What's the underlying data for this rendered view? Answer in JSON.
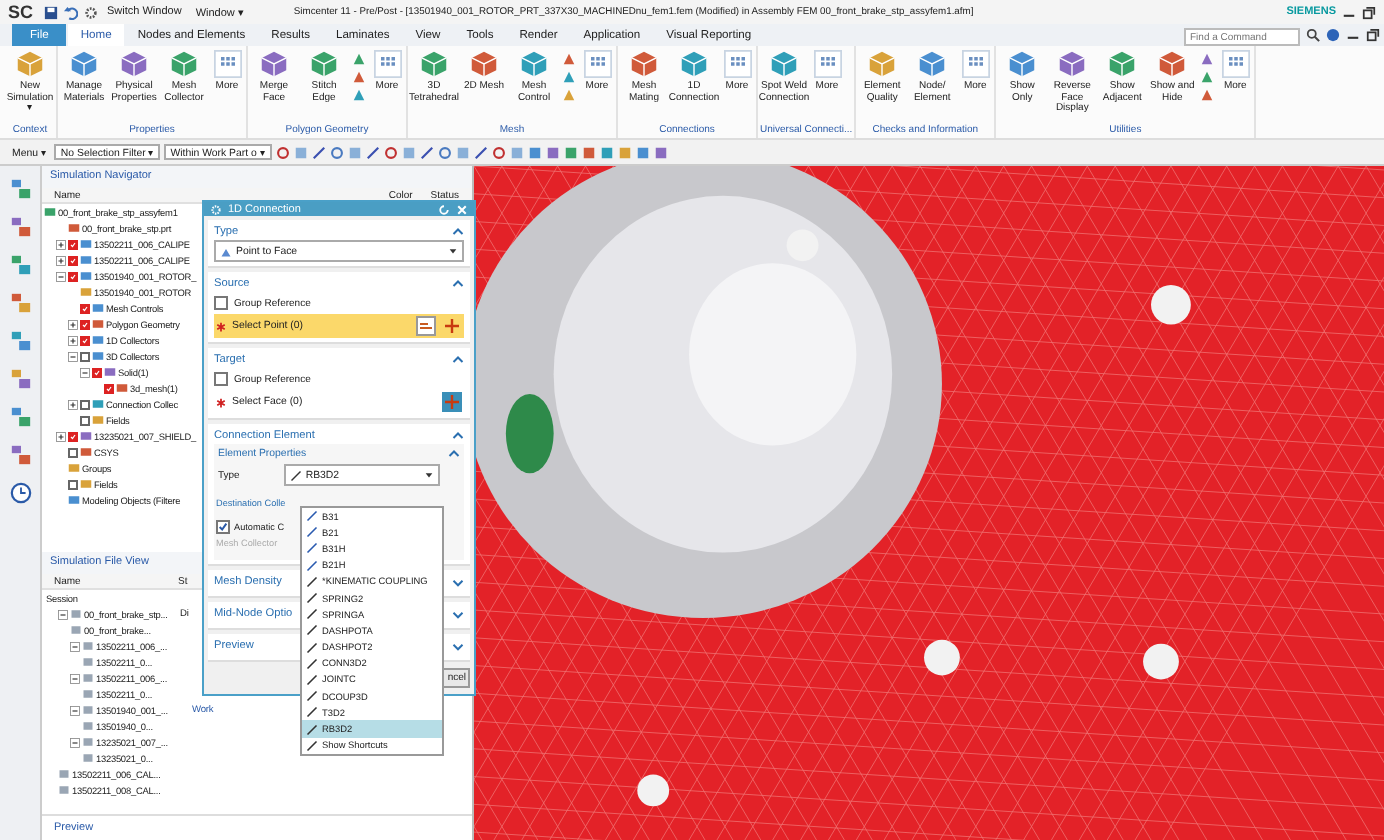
{
  "title_bar": {
    "logo": "SC",
    "switch_window": "Switch Window",
    "window_menu": "Window ▾",
    "title": "Simcenter 11 - Pre/Post - [13501940_001_ROTOR_PRT_337X30_MACHINEDnu_fem1.fem (Modified)  in Assembly FEM 00_front_brake_stp_assyfem1.afm]",
    "brand": "SIEMENS"
  },
  "menu_tabs": [
    {
      "label": "File",
      "kind": "file",
      "selected": false
    },
    {
      "label": "Home",
      "kind": "tab",
      "selected": true
    },
    {
      "label": "Nodes and Elements",
      "kind": "tab",
      "selected": false
    },
    {
      "label": "Results",
      "kind": "tab",
      "selected": false
    },
    {
      "label": "Laminates",
      "kind": "tab",
      "selected": false
    },
    {
      "label": "View",
      "kind": "tab",
      "selected": false
    },
    {
      "label": "Tools",
      "kind": "tab",
      "selected": false
    },
    {
      "label": "Render",
      "kind": "tab",
      "selected": false
    },
    {
      "label": "Application",
      "kind": "tab",
      "selected": false
    },
    {
      "label": "Visual Reporting",
      "kind": "tab",
      "selected": false
    }
  ],
  "command_search": {
    "placeholder": "Find a Command"
  },
  "ribbon_groups": [
    {
      "label": "Context",
      "buttons": [
        {
          "kind": "button",
          "label": "New Simulation ▾"
        }
      ]
    },
    {
      "label": "Properties",
      "buttons": [
        {
          "kind": "button",
          "label": "Manage Materials"
        },
        {
          "kind": "button",
          "label": "Physical Properties"
        },
        {
          "kind": "button",
          "label": "Mesh Collector"
        },
        {
          "kind": "more",
          "label": "More"
        }
      ]
    },
    {
      "label": "Polygon Geometry",
      "buttons": [
        {
          "kind": "button",
          "label": "Merge Face"
        },
        {
          "kind": "button",
          "label": "Stitch Edge"
        },
        {
          "kind": "stack"
        },
        {
          "kind": "more",
          "label": "More"
        }
      ]
    },
    {
      "label": "Mesh",
      "buttons": [
        {
          "kind": "button",
          "label": "3D Tetrahedral"
        },
        {
          "kind": "button",
          "label": "2D Mesh"
        },
        {
          "kind": "button",
          "label": "Mesh Control"
        },
        {
          "kind": "stack"
        },
        {
          "kind": "more",
          "label": "More"
        }
      ]
    },
    {
      "label": "Connections",
      "buttons": [
        {
          "kind": "button",
          "label": "Mesh Mating"
        },
        {
          "kind": "button",
          "label": "1D Connection"
        },
        {
          "kind": "more",
          "label": "More"
        }
      ]
    },
    {
      "label": "Universal Connecti...",
      "buttons": [
        {
          "kind": "button",
          "label": "Spot Weld Connection"
        },
        {
          "kind": "more",
          "label": "More"
        }
      ]
    },
    {
      "label": "Checks and Information",
      "buttons": [
        {
          "kind": "button",
          "label": "Element Quality"
        },
        {
          "kind": "button",
          "label": "Node/ Element"
        },
        {
          "kind": "more",
          "label": "More"
        }
      ]
    },
    {
      "label": "Utilities",
      "buttons": [
        {
          "kind": "button",
          "label": "Show Only"
        },
        {
          "kind": "button",
          "label": "Reverse Face Display"
        },
        {
          "kind": "button",
          "label": "Show Adjacent"
        },
        {
          "kind": "button",
          "label": "Show and Hide"
        },
        {
          "kind": "stack"
        },
        {
          "kind": "more",
          "label": "More"
        }
      ]
    }
  ],
  "toolbar": {
    "menu": "Menu ▾",
    "filter": "No Selection Filter ▾",
    "scope": "Within Work Part o ▾"
  },
  "navigator": {
    "title": "Simulation Navigator",
    "columns": [
      "Name",
      "Color",
      "Status"
    ],
    "tree": [
      {
        "label": "00_front_brake_stp_assyfem1",
        "children": [
          {
            "label": "00_front_brake_stp.prt"
          },
          {
            "label": "13502211_006_CALIPE",
            "expanded": false,
            "checked": true
          },
          {
            "label": "13502211_006_CALIPE",
            "expanded": false,
            "checked": true
          },
          {
            "label": "13501940_001_ROTOR_",
            "expanded": true,
            "checked": true,
            "children": [
              {
                "label": "13501940_001_ROTOR"
              },
              {
                "label": "Mesh Controls",
                "checked": true
              },
              {
                "label": "Polygon Geometry",
                "expanded": false,
                "checked": true
              },
              {
                "label": "1D Collectors",
                "expanded": false,
                "checked": true
              },
              {
                "label": "3D Collectors",
                "expanded": true,
                "checked": false,
                "children": [
                  {
                    "label": "Solid(1)",
                    "expanded": true,
                    "checked": true,
                    "children": [
                      {
                        "label": "3d_mesh(1)",
                        "checked": true
                      }
                    ]
                  }
                ]
              },
              {
                "label": "Connection Collec",
                "expanded": false,
                "checked": false
              },
              {
                "label": "Fields",
                "checked": false
              }
            ]
          },
          {
            "label": "13235021_007_SHIELD_",
            "expanded": false,
            "checked": true
          },
          {
            "label": "CSYS",
            "checked": false
          },
          {
            "label": "Groups"
          },
          {
            "label": "Fields",
            "checked": false
          },
          {
            "label": "Modeling Objects (Filtere"
          }
        ]
      }
    ]
  },
  "file_view": {
    "title": "Simulation File View",
    "columns": [
      "Name",
      "St"
    ],
    "tree": [
      {
        "label": "Session",
        "children": [
          {
            "label": "00_front_brake_stp...",
            "status": "Di",
            "expanded": true,
            "children": [
              {
                "label": "00_front_brake..."
              },
              {
                "label": "13502211_006_...",
                "expanded": true,
                "children": [
                  {
                    "label": "13502211_0..."
                  }
                ]
              },
              {
                "label": "13502211_006_...",
                "expanded": true,
                "children": [
                  {
                    "label": "13502211_0..."
                  }
                ]
              },
              {
                "label": "13501940_001_...",
                "status": "Work",
                "expanded": true,
                "children": [
                  {
                    "label": "13501940_0..."
                  }
                ]
              },
              {
                "label": "13235021_007_...",
                "expanded": true,
                "children": [
                  {
                    "label": "13235021_0..."
                  }
                ]
              }
            ]
          },
          {
            "label": "13502211_006_CAL..."
          },
          {
            "label": "13502211_008_CAL..."
          }
        ]
      }
    ]
  },
  "preview_label": "Preview",
  "dialog": {
    "title": "1D Connection",
    "sections": [
      {
        "kind": "select",
        "title": "Type",
        "expanded": true,
        "value": "Point to Face"
      },
      {
        "kind": "selection",
        "title": "Source",
        "expanded": true,
        "group_reference": {
          "label": "Group Reference",
          "checked": false
        },
        "select": {
          "label": "Select Point (0)",
          "active": true
        }
      },
      {
        "kind": "selection",
        "title": "Target",
        "expanded": true,
        "group_reference": {
          "label": "Group Reference",
          "checked": false
        },
        "select": {
          "label": "Select Face (0)",
          "active": false
        }
      },
      {
        "kind": "element",
        "title": "Connection Element",
        "expanded": true,
        "subsection": "Element Properties",
        "type_label": "Type",
        "type_value": "RB3D2",
        "destination": "Destination Colle",
        "automatic": {
          "label": "Automatic C",
          "checked": true
        },
        "mesh_collector": "Mesh Collector"
      },
      {
        "kind": "collapsed",
        "title": "Mesh Density",
        "expanded": false
      },
      {
        "kind": "collapsed",
        "title": "Mid-Node Optio",
        "expanded": false
      },
      {
        "kind": "collapsed",
        "title": "Preview",
        "expanded": false
      }
    ],
    "cancel": "ncel"
  },
  "type_dropdown": {
    "items": [
      {
        "label": "B31",
        "selected": false
      },
      {
        "label": "B21",
        "selected": false
      },
      {
        "label": "B31H",
        "selected": false
      },
      {
        "label": "B21H",
        "selected": false
      },
      {
        "label": "*KINEMATIC COUPLING",
        "selected": false
      },
      {
        "label": "SPRING2",
        "selected": false
      },
      {
        "label": "SPRINGA",
        "selected": false
      },
      {
        "label": "DASHPOTA",
        "selected": false
      },
      {
        "label": "DASHPOT2",
        "selected": false
      },
      {
        "label": "CONN3D2",
        "selected": false
      },
      {
        "label": "JOINTC",
        "selected": false
      },
      {
        "label": "DCOUP3D",
        "selected": false
      },
      {
        "label": "T3D2",
        "selected": false
      },
      {
        "label": "RB3D2",
        "selected": true
      },
      {
        "label": "Show Shortcuts",
        "selected": false
      }
    ]
  }
}
